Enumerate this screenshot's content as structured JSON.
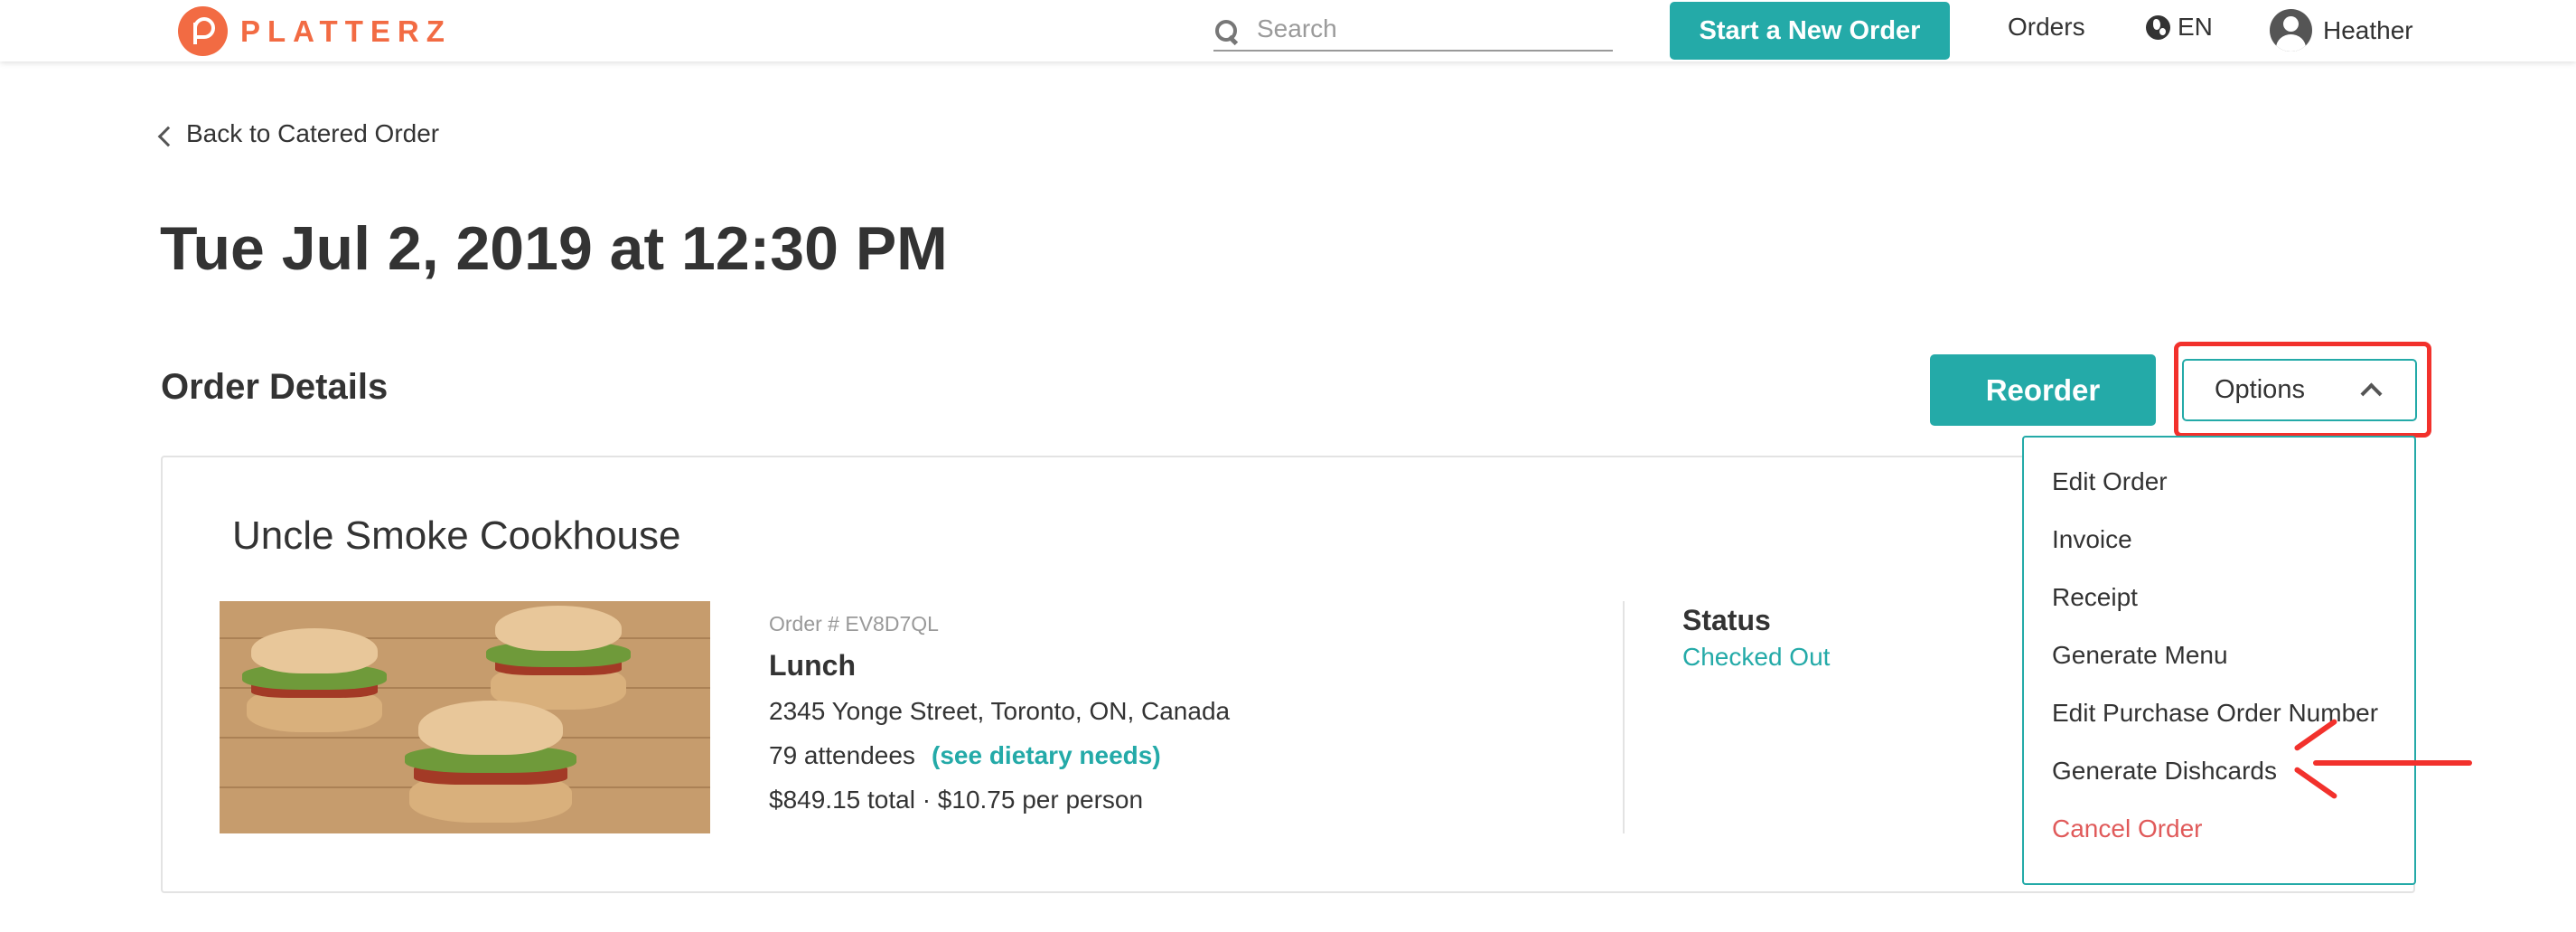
{
  "header": {
    "logo_text": "PLATTERZ",
    "search_placeholder": "Search",
    "start_order_label": "Start a New Order",
    "orders_label": "Orders",
    "language_label": "EN",
    "user_name": "Heather"
  },
  "back_link": "Back to Catered Order",
  "page_title": "Tue Jul 2, 2019 at 12:30 PM",
  "section_title": "Order Details",
  "reorder_label": "Reorder",
  "options_label": "Options",
  "order": {
    "restaurant": "Uncle Smoke Cookhouse",
    "order_number": "Order # EV8D7QL",
    "meal": "Lunch",
    "address": "2345 Yonge Street, Toronto, ON, Canada",
    "attendees": "79 attendees",
    "dietary_link": "(see dietary needs)",
    "totals": "$849.15 total  ·  $10.75 per person",
    "status_label": "Status",
    "status_value": "Checked Out"
  },
  "options_menu": [
    {
      "label": "Edit Order"
    },
    {
      "label": "Invoice"
    },
    {
      "label": "Receipt"
    },
    {
      "label": "Generate Menu"
    },
    {
      "label": "Edit Purchase Order Number"
    },
    {
      "label": "Generate Dishcards"
    },
    {
      "label": "Cancel Order"
    }
  ],
  "colors": {
    "brand": "#f26b43",
    "accent": "#24aaa8",
    "danger": "#e05a5a",
    "annotation": "#f2312c"
  }
}
